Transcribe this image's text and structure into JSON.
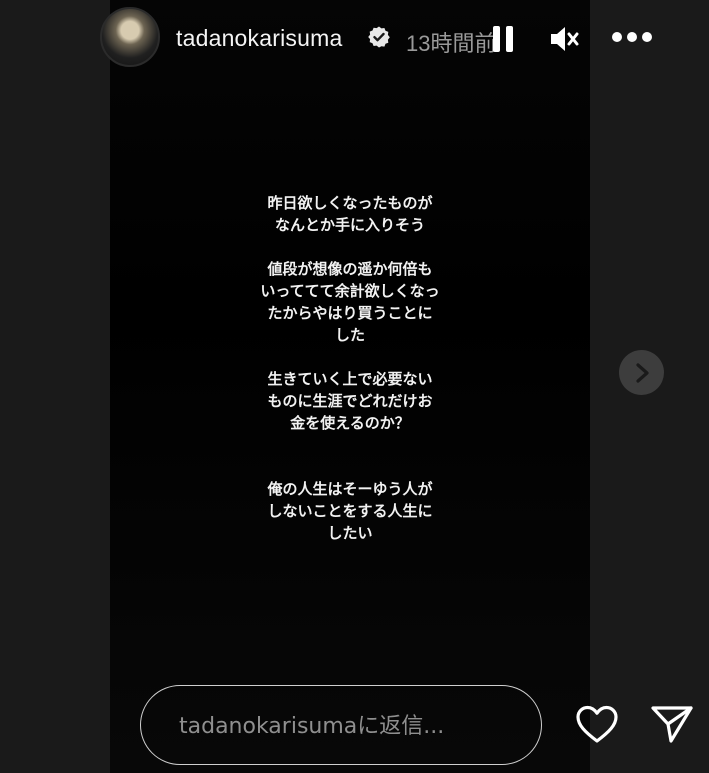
{
  "header": {
    "username": "tadanokarisuma",
    "time_ago": "13時間前",
    "icons": {
      "verified": "verified-badge-icon",
      "pause": "pause-icon",
      "mute": "speaker-muted-icon",
      "more": "more-horizontal-icon"
    }
  },
  "story": {
    "paragraphs": [
      [
        "昨日欲しくなったものが",
        "なんとか手に入りそう"
      ],
      [
        "値段が想像の遥か何倍も",
        "いっててて余計欲しくなっ",
        "たからやはり買うことに",
        "した"
      ],
      [
        "生きていく上で必要ない",
        "ものに生涯でどれだけお",
        "金を使えるのか？"
      ],
      [
        "俺の人生はそーゆう人が",
        "しないことをする人生に",
        "したい"
      ]
    ]
  },
  "navigation": {
    "next_icon": "chevron-right-icon"
  },
  "footer": {
    "reply_placeholder": "tadanokarisumaに返信...",
    "like_icon": "heart-icon",
    "share_icon": "paper-plane-icon"
  },
  "colors": {
    "background": "#1a1a1a",
    "story_background": "#000000",
    "text": "#f2f2f2",
    "muted_text": "#9a9a9a"
  }
}
